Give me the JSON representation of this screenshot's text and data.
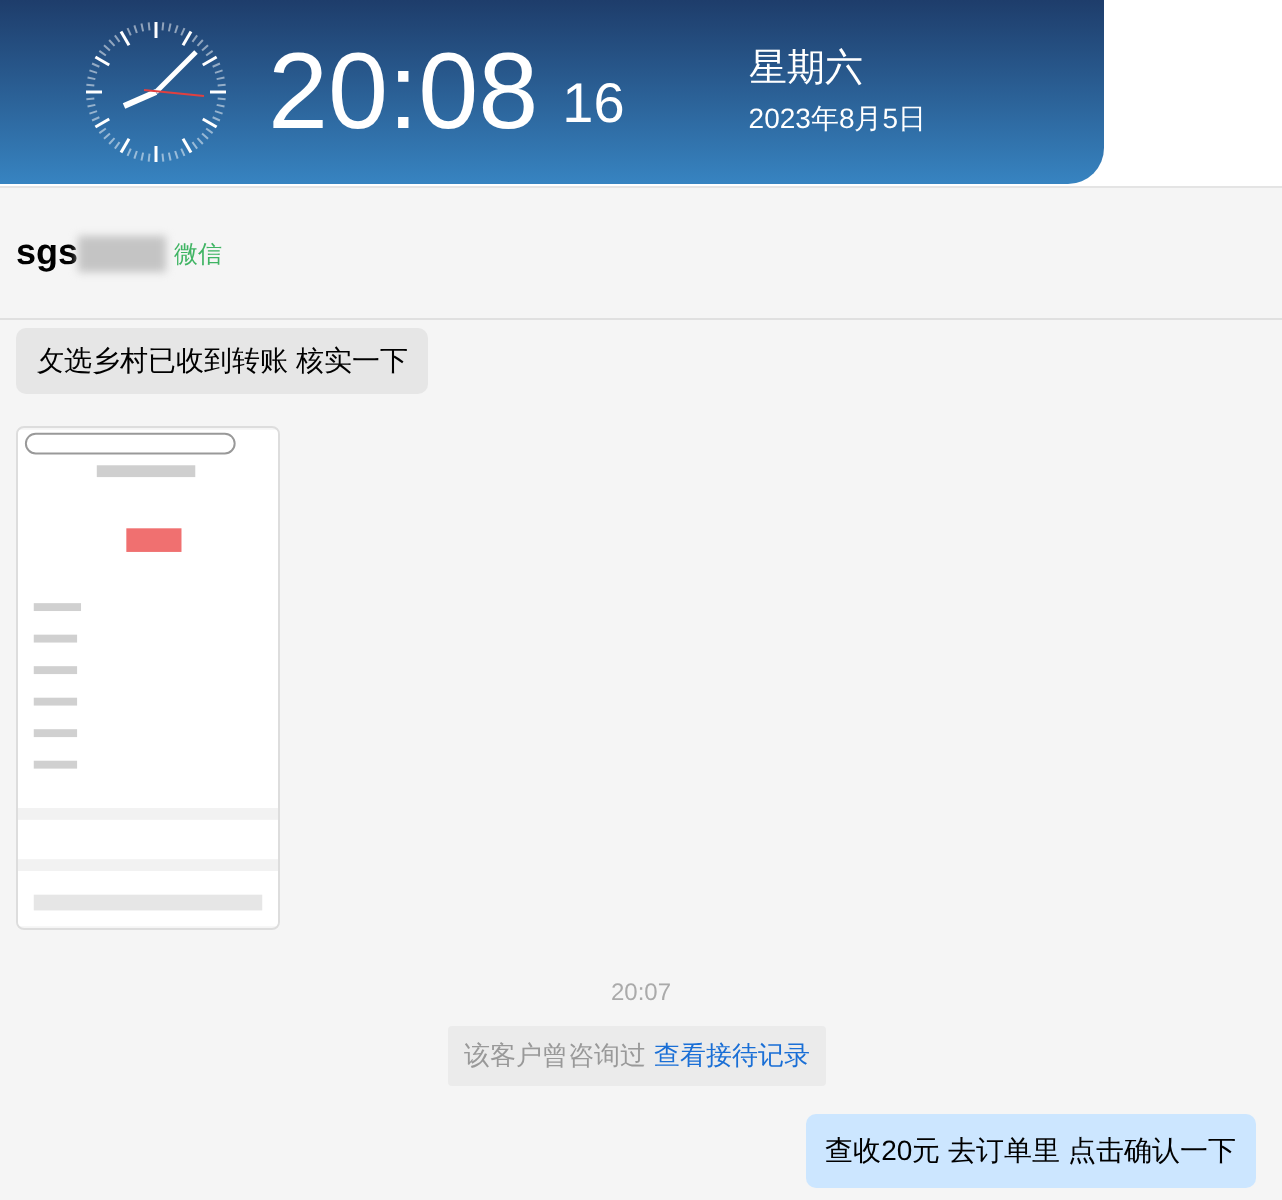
{
  "header": {
    "time": "20:08",
    "seconds": "16",
    "weekday": "星期六",
    "date": "2023年8月5日"
  },
  "contact": {
    "name": "sgs",
    "source": "微信"
  },
  "messages": [
    {
      "kind": "text",
      "outgoing": false,
      "text": "攵选乡村已收到转账  核实一下"
    },
    {
      "kind": "picture",
      "outgoing": false
    },
    {
      "kind": "time",
      "text": "20:07"
    },
    {
      "kind": "notice",
      "text": "该客户曾咨询过",
      "link": "查看接待记录"
    },
    {
      "kind": "text",
      "outgoing": true,
      "text": "查收20元  去订单里 点击确认一下"
    }
  ]
}
